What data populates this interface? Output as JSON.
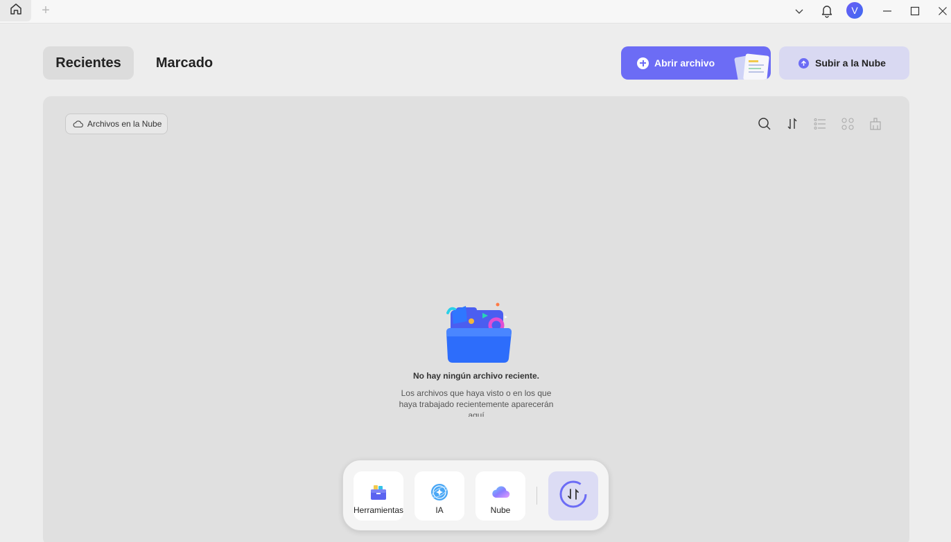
{
  "titlebar": {
    "new_tab_label": "+",
    "avatar_initial": "V"
  },
  "tabs": {
    "recent": "Recientes",
    "marked": "Marcado"
  },
  "actions": {
    "open_file": "Abrir archivo",
    "upload_cloud": "Subir a la Nube"
  },
  "toolbar": {
    "cloud_files": "Archivos en la Nube",
    "icons": [
      "search-icon",
      "sort-icon",
      "list-view-icon",
      "grid-view-icon",
      "clear-icon"
    ]
  },
  "empty_state": {
    "title": "No hay ningún archivo reciente.",
    "description": "Los archivos que haya visto o en los que haya trabajado recientemente aparecerán aquí"
  },
  "dock": {
    "tools": "Herramientas",
    "ai": "IA",
    "cloud": "Nube"
  },
  "colors": {
    "accent": "#6c6cf5",
    "accent_light": "#d9d9f2",
    "avatar": "#5563f2"
  }
}
